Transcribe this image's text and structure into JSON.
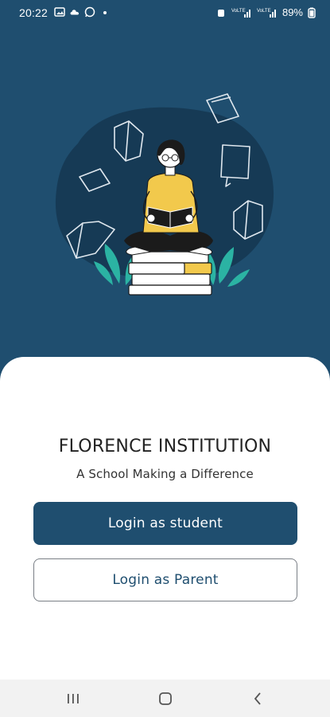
{
  "status_bar": {
    "time": "20:22",
    "battery": "89%",
    "left_icons": [
      "image-icon",
      "cloud-icon",
      "whatsapp-icon",
      "dot-icon"
    ],
    "right_icons": [
      "alarm-icon",
      "signal-icon",
      "signal-icon",
      "battery-icon"
    ]
  },
  "colors": {
    "hero_background": "#1f4e6f",
    "accent": "#1f4e6f",
    "blob": "#163a55",
    "shirt": "#f2c94c",
    "leaf": "#2bb3a3"
  },
  "illustration": {
    "icon": "student-reading-illustration"
  },
  "main": {
    "school_name": "FLORENCE INSTITUTION",
    "tagline": "A School Making a Difference",
    "student_button_label": "Login as student",
    "parent_button_label": "Login as Parent"
  },
  "nav_bar": {
    "items": [
      "recents-icon",
      "home-icon",
      "back-icon"
    ]
  }
}
